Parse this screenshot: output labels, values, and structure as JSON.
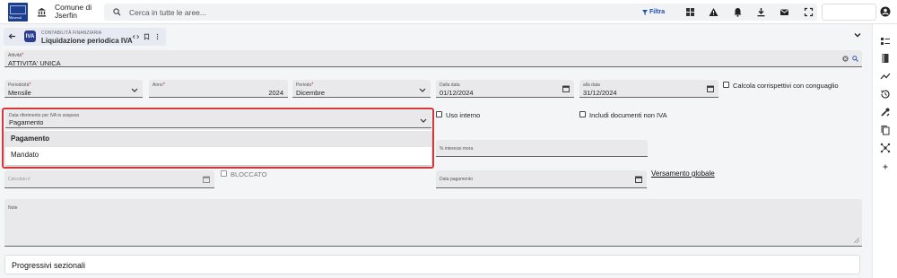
{
  "header": {
    "logo_text": "Maserati",
    "municipality": "Comune di Jserfin",
    "search_placeholder": "Cerca in tutte le aree...",
    "filter_label": "Filtra"
  },
  "tab": {
    "badge": "IVA",
    "module": "CONTABILITÀ FINANZIARIA",
    "title": "Liquidazione periodica IVA"
  },
  "form": {
    "attivita": {
      "label": "Attività",
      "value": "ATTIVITA' UNICA"
    },
    "periodicita": {
      "label": "Periodicità",
      "value": "Mensile"
    },
    "anno": {
      "label": "Anno",
      "value": "2024"
    },
    "periodo": {
      "label": "Periodo",
      "value": "Dicembre"
    },
    "dalla_data": {
      "label": "Dalla data",
      "value": "01/12/2024"
    },
    "alla_data": {
      "label": "alla data",
      "value": "31/12/2024"
    },
    "calcola_label": "Calcola corrispettivi con conguaglio",
    "data_rif": {
      "label": "Data riferimento per IVA in sospeso",
      "value": "Pagamento"
    },
    "dropdown_options": [
      "Pagamento",
      "Mandato"
    ],
    "uso_interno_label": "Uso interno",
    "includi_label": "Includi documenti non IVA",
    "interessi_placeholder": "% interessi mora",
    "calcolato_placeholder": "Calcolato il",
    "bloccato_label": "BLOCCATO",
    "data_pagamento_placeholder": "Data pagamento",
    "versamento_link": "Versamento globale",
    "note_placeholder": "Note",
    "progressivi_label": "Progressivi sezionali"
  },
  "colors": {
    "accent": "#1f4db8",
    "highlight": "#d93838",
    "required": "#d32f2f"
  }
}
